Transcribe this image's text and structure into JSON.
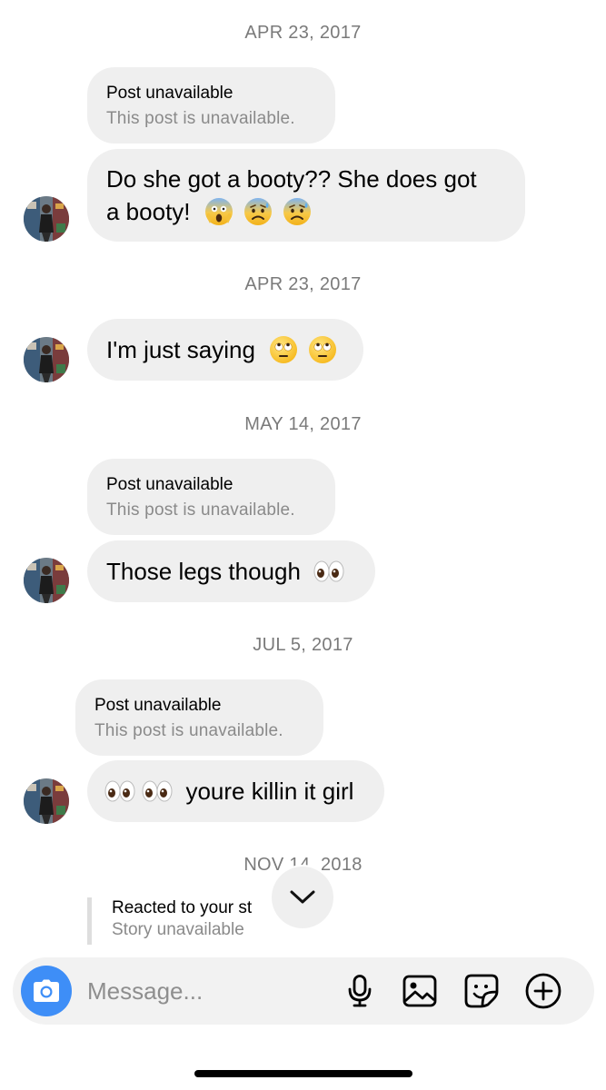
{
  "dates": {
    "d1": "APR 23, 2017",
    "d2": "APR 23, 2017",
    "d3": "MAY 14, 2017",
    "d4": "JUL 5, 2017",
    "d5": "NOV 14, 2018"
  },
  "posts": {
    "p1": {
      "title": "Post unavailable",
      "subtitle": "This post is unavailable."
    },
    "p2": {
      "title": "Post unavailable",
      "subtitle": "This post is unavailable."
    },
    "p3": {
      "title": "Post unavailable",
      "subtitle": "This post is unavailable."
    }
  },
  "messages": {
    "m1_line1": "Do she got a booty?? She does got",
    "m1_line2": "a booty!",
    "m1_emojis": [
      "face-screaming-in-fear",
      "anxious-face-with-sweat",
      "anxious-face-with-sweat"
    ],
    "m2_text": "I'm just saying",
    "m2_emojis": [
      "face-with-rolling-eyes",
      "face-with-rolling-eyes"
    ],
    "m3_text": "Those legs though",
    "m3_emojis": [
      "eyes"
    ],
    "m4_text": "youre killin it girl",
    "m4_emojis": [
      "eyes",
      "eyes"
    ]
  },
  "story_reply": {
    "title": "Reacted to your st",
    "subtitle": "Story unavailable"
  },
  "composer": {
    "placeholder": "Message..."
  },
  "colors": {
    "bubble": "#efefef",
    "camera_button": "#3e8ef7",
    "date_text": "#7a7a7a",
    "muted_text": "#8a8a8a"
  }
}
